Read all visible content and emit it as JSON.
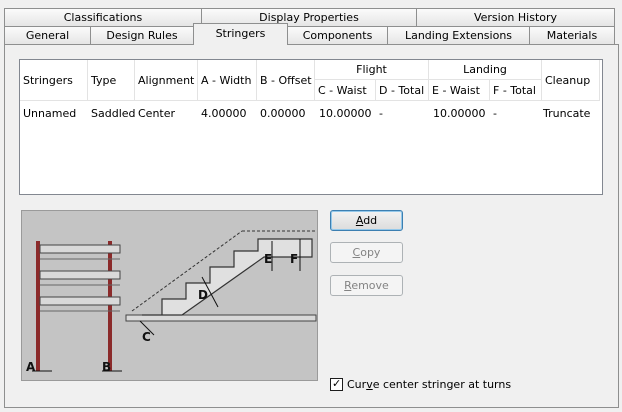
{
  "tabs_back": [
    {
      "label": "Classifications"
    },
    {
      "label": "Display Properties"
    },
    {
      "label": "Version History"
    }
  ],
  "tabs_front": [
    {
      "label": "General"
    },
    {
      "label": "Design Rules"
    },
    {
      "label": "Stringers"
    },
    {
      "label": "Components"
    },
    {
      "label": "Landing Extensions"
    },
    {
      "label": "Materials"
    }
  ],
  "active_tab": "Stringers",
  "table": {
    "group_headers": {
      "flight": "Flight",
      "landing": "Landing"
    },
    "columns": {
      "stringers": "Stringers",
      "type": "Type",
      "alignment": "Alignment",
      "a_width": "A - Width",
      "b_offset": "B - Offset",
      "c_waist": "C - Waist",
      "d_total": "D - Total",
      "e_waist": "E - Waist",
      "f_total": "F - Total",
      "cleanup": "Cleanup"
    },
    "rows": [
      {
        "stringers": "Unnamed",
        "type": "Saddled",
        "alignment": "Center",
        "a_width": "4.00000",
        "b_offset": "0.00000",
        "c_waist": "10.00000",
        "d_total": "-",
        "e_waist": "10.00000",
        "f_total": "-",
        "cleanup": "Truncate"
      }
    ]
  },
  "illustration": {
    "labels": {
      "a": "A",
      "b": "B",
      "c": "C",
      "d": "D",
      "e": "E",
      "f": "F"
    }
  },
  "buttons": {
    "add": {
      "label": "Add",
      "mnemonic": "A",
      "rest": "dd"
    },
    "copy": {
      "label": "Copy",
      "mnemonic": "C",
      "rest": "opy"
    },
    "remove": {
      "label": "Remove",
      "mnemonic": "R",
      "rest": "emove"
    }
  },
  "checkbox": {
    "label_pre": "Cur",
    "label_mnemonic": "v",
    "label_post": "e center stringer at turns",
    "checked": true
  }
}
